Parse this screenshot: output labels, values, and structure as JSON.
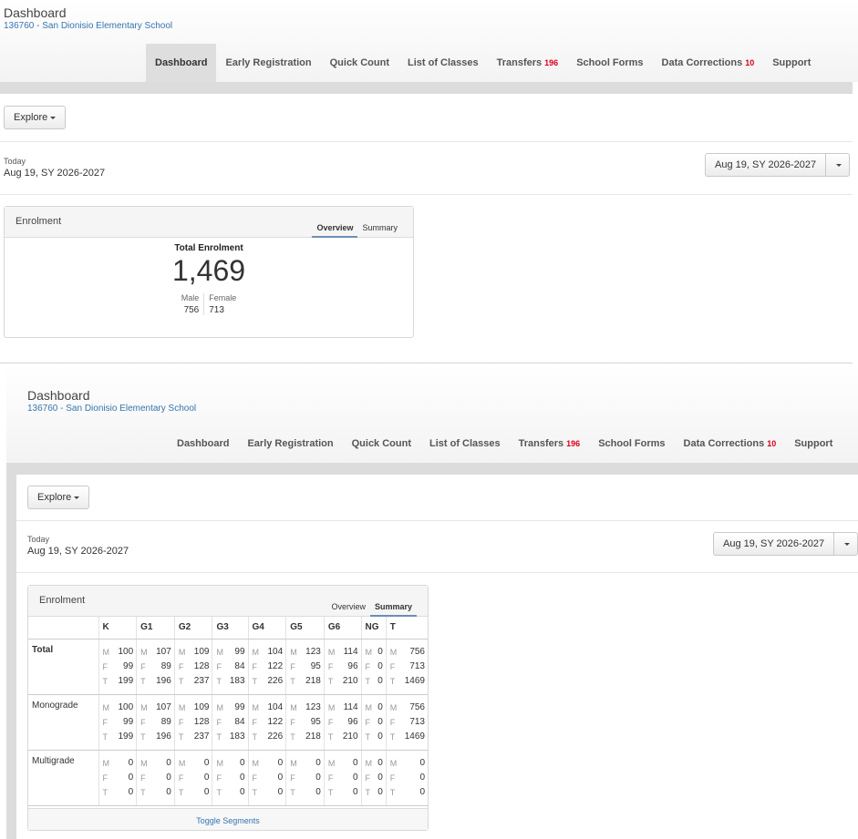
{
  "app": {
    "title": "Dashboard",
    "school": "136760 - San Dionisio Elementary School"
  },
  "nav": [
    {
      "label": "Dashboard",
      "count": ""
    },
    {
      "label": "Early Registration",
      "count": ""
    },
    {
      "label": "Quick Count",
      "count": ""
    },
    {
      "label": "List of Classes",
      "count": ""
    },
    {
      "label": "Transfers",
      "count": "196"
    },
    {
      "label": "School Forms",
      "count": ""
    },
    {
      "label": "Data Corrections",
      "count": "10"
    },
    {
      "label": "Support",
      "count": ""
    }
  ],
  "explore_label": "Explore",
  "today": {
    "label": "Today",
    "value": "Aug 19, SY 2026-2027"
  },
  "date_picker": {
    "value": "Aug 19, SY 2026-2027"
  },
  "enrolment": {
    "title": "Enrolment",
    "tabs": {
      "overview": "Overview",
      "summary": "Summary"
    },
    "overview": {
      "title": "Total Enrolment",
      "total": "1,469",
      "male_label": "Male",
      "female_label": "Female",
      "male": "756",
      "female": "713"
    },
    "summary": {
      "columns": [
        "K",
        "G1",
        "G2",
        "G3",
        "G4",
        "G5",
        "G6",
        "NG",
        "T"
      ],
      "letters": {
        "m": "M",
        "f": "F",
        "t": "T"
      },
      "rows": [
        {
          "label": "Total",
          "m": [
            "100",
            "107",
            "109",
            "99",
            "104",
            "123",
            "114",
            "0",
            "756"
          ],
          "f": [
            "99",
            "89",
            "128",
            "84",
            "122",
            "95",
            "96",
            "0",
            "713"
          ],
          "t": [
            "199",
            "196",
            "237",
            "183",
            "226",
            "218",
            "210",
            "0",
            "1469"
          ]
        },
        {
          "label": "Monograde",
          "m": [
            "100",
            "107",
            "109",
            "99",
            "104",
            "123",
            "114",
            "0",
            "756"
          ],
          "f": [
            "99",
            "89",
            "128",
            "84",
            "122",
            "95",
            "96",
            "0",
            "713"
          ],
          "t": [
            "199",
            "196",
            "237",
            "183",
            "226",
            "218",
            "210",
            "0",
            "1469"
          ]
        },
        {
          "label": "Multigrade",
          "m": [
            "0",
            "0",
            "0",
            "0",
            "0",
            "0",
            "0",
            "0",
            "0"
          ],
          "f": [
            "0",
            "0",
            "0",
            "0",
            "0",
            "0",
            "0",
            "0",
            "0"
          ],
          "t": [
            "0",
            "0",
            "0",
            "0",
            "0",
            "0",
            "0",
            "0",
            "0"
          ]
        }
      ],
      "toggle_label": "Toggle Segments"
    }
  },
  "colors": {
    "link": "#3575b0",
    "badge": "#d9001b",
    "tab_underline": "#6b8fb6"
  }
}
